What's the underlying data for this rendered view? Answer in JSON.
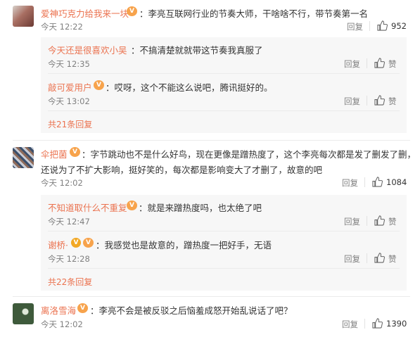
{
  "comments": [
    {
      "name": "爱神巧克力给我来一块",
      "text": "：李亮互联网行业的节奏大师，干啥啥不行，带节奏第一名",
      "time": "今天 12:22",
      "reply": "回复",
      "likes": "952",
      "replies": [
        {
          "name": "今天还是很喜欢小吴",
          "text": "：不搞清楚就就带这节奏我真服了",
          "time": "今天 12:35",
          "reply": "回复",
          "like": "赞"
        },
        {
          "name": "敲可爱用户",
          "text": "：哎呀，这个不能这么说吧，腾讯挺好的。",
          "time": "今天 13:02",
          "reply": "回复",
          "like": "赞"
        }
      ],
      "more": "共21条回复"
    },
    {
      "name": "伞把菌",
      "text_line1": "：字节跳动也不是什么好鸟，现在更像是蹭热度了，这个李亮每次都是发了删发了删，",
      "text_line2": "还说为了不扩大影响，挺好笑的，每次都是影响变大了才删了，故意的吧",
      "time": "今天 12:02",
      "reply": "回复",
      "likes": "1084",
      "replies": [
        {
          "name": "不知道取什么不重复",
          "text": "：就是来蹭热度吗，也太绝了吧",
          "time": "今天 12:47",
          "reply": "回复",
          "like": "赞"
        },
        {
          "name": "谢桥·",
          "text": "：我感觉也是故意的，蹭热度一把好手，无语",
          "time": "今天 12:28",
          "reply": "回复",
          "like": "赞"
        }
      ],
      "more": "共22条回复"
    },
    {
      "name": "离洛雪海",
      "text": "：李亮不会是被反驳之后恼羞成怒开始乱说话了吧？",
      "time": "今天 12:02",
      "reply": "回复",
      "likes": "1390"
    }
  ],
  "colors": {
    "name": "#eb7350",
    "meta": "#808080",
    "text": "#333333",
    "badge": "#f7a34c"
  },
  "icons": {
    "like": "thumbs-up-icon",
    "vip_badge": "vip-badge-icon",
    "verified": "verified-v-icon"
  }
}
